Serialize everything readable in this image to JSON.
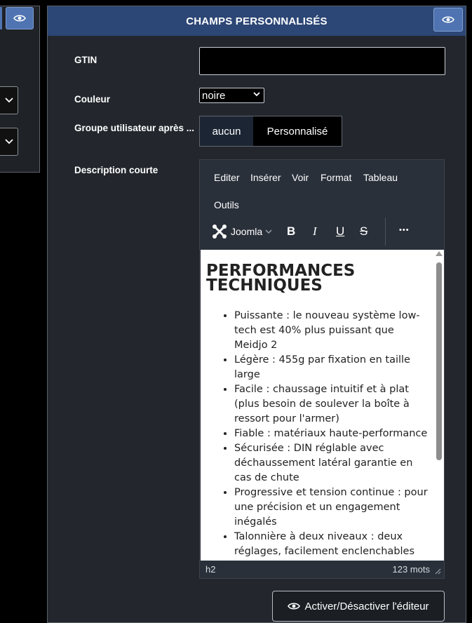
{
  "panel": {
    "title": "CHAMPS PERSONNALISÉS",
    "eye_icon": "eye-icon"
  },
  "fields": {
    "gtin_label": "GTIN",
    "gtin_value": "",
    "couleur_label": "Couleur",
    "couleur_value": "noire",
    "groupe_label": "Groupe utilisateur après ...",
    "groupe_options": [
      "aucun",
      "Personnalisé"
    ],
    "description_label": "Description courte"
  },
  "editor": {
    "menu": [
      "Editer",
      "Insérer",
      "Voir",
      "Format",
      "Tableau",
      "Outils"
    ],
    "toolbar": {
      "joomla_label": "Joomla",
      "bold": "B",
      "italic": "I",
      "underline": "U",
      "strike": "S",
      "more": "•••"
    },
    "heading": "PERFORMANCES TECHNIQUES",
    "bullets": [
      "Puissante : le nouveau système low-tech est 40% plus puissant que Meidjo 2",
      "Légère : 455g par fixation en taille large",
      "Facile : chaussage intuitif et à plat (plus besoin de soulever la boîte à ressort pour l'armer)",
      "Fiable : matériaux haute-performance",
      "Sécurisée : DIN réglable avec déchaussement latéral garantie en cas de chute",
      "Progressive et tension continue : pour une précision et un engagement inégalés",
      "Talonnière à deux niveaux : deux réglages, facilement enclenchables"
    ],
    "status_path": "h2",
    "word_count": "123 mots"
  },
  "activate_button": "Activer/Désactiver l'éditeur",
  "colors": {
    "header": "#2c4675",
    "panel": "#23272d",
    "eye_button": "#4f74b1"
  }
}
